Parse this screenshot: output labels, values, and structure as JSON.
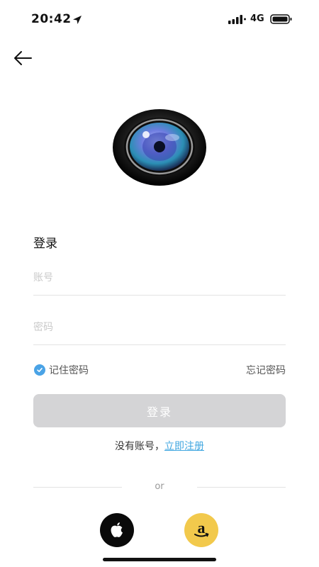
{
  "status_bar": {
    "time": "20:42",
    "network": "4G",
    "icons": [
      "location-arrow-icon",
      "signal-icon",
      "battery-icon"
    ]
  },
  "header": {
    "back_icon": "back-arrow-icon"
  },
  "logo": {
    "icon": "camera-lens-icon"
  },
  "form": {
    "title": "登录",
    "account_placeholder": "账号",
    "account_value": "",
    "password_placeholder": "密码",
    "password_value": "",
    "remember_label": "记住密码",
    "remember_checked": true,
    "forgot_label": "忘记密码",
    "login_button": "登录"
  },
  "register": {
    "prompt": "没有账号，",
    "link": "立即注册"
  },
  "divider": {
    "text": "or"
  },
  "social": {
    "apple_icon": "apple-icon",
    "amazon_icon": "amazon-icon"
  },
  "colors": {
    "accent": "#3fa6e0",
    "button_disabled": "#d4d4d6",
    "amazon_bg": "#f2c94c"
  }
}
